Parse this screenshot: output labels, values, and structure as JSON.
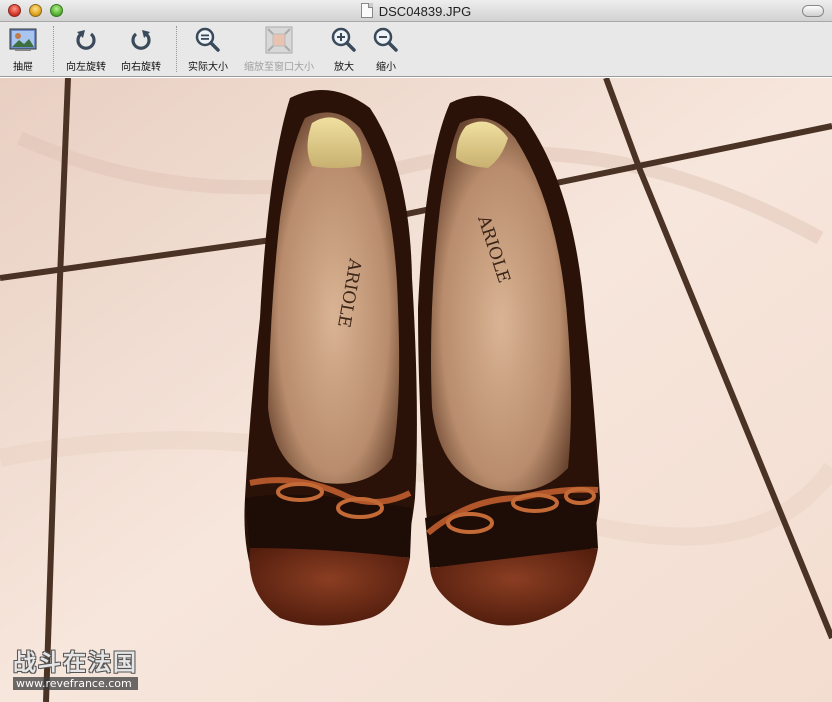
{
  "window": {
    "title": "DSC04839.JPG"
  },
  "toolbar": {
    "drawer": "抽屉",
    "rotate_left": "向左旋转",
    "rotate_right": "向右旋转",
    "actual_size": "实际大小",
    "zoom_to_fit": "缩放至窗口大小",
    "zoom_in": "放大",
    "zoom_out": "缩小"
  },
  "photo": {
    "insole_brand_left": "ARIOLE",
    "insole_brand_right": "ARIOLE"
  },
  "watermark": {
    "text": "战斗在法国",
    "url": "www.revefrance.com"
  },
  "colors": {
    "tile": "#f2dccf",
    "grout": "#4a3224",
    "shoe_leather": "#2a1208",
    "toe_wood": "#5a2412",
    "insole": "#c89d7a"
  }
}
